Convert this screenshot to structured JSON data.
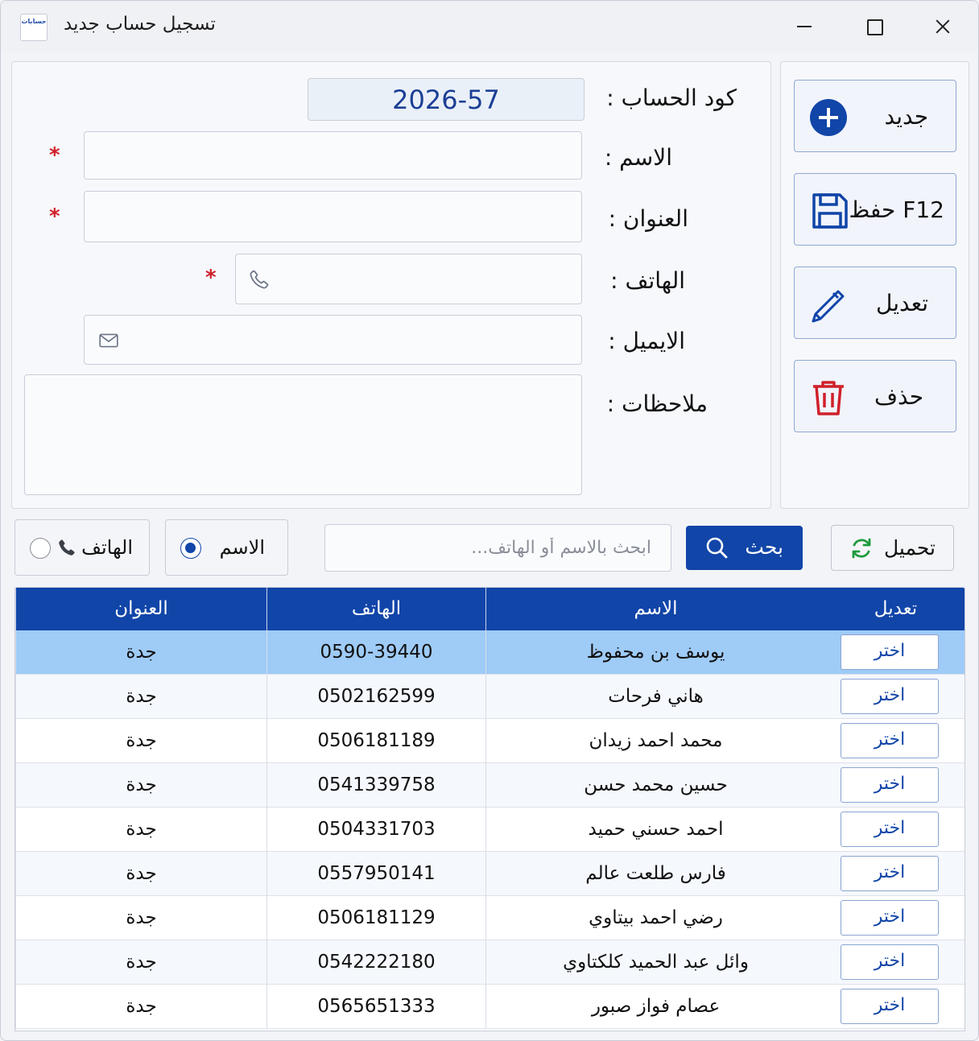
{
  "window": {
    "title": "تسجيل حساب جديد",
    "app_icon_text": "حسابات"
  },
  "form": {
    "code_label": "كود الحساب :",
    "code_value": "2026-57",
    "name_label": "الاسم :",
    "address_label": "العنوان :",
    "phone_label": "الهاتف :",
    "email_label": "الايميل :",
    "notes_label": "ملاحظات :",
    "required_mark": "*"
  },
  "actions": {
    "new_label": "جديد",
    "save_label": "F12 حفظ",
    "edit_label": "تعديل",
    "delete_label": "حذف"
  },
  "search": {
    "by_name_label": "الاسم",
    "by_phone_label": "الهاتف",
    "selected_mode": "name",
    "placeholder": "ابحث بالاسم أو الهاتف...",
    "search_label": "بحث",
    "load_label": "تحميل"
  },
  "colors": {
    "accent": "#1145a8",
    "selected_row": "#9fcbf7",
    "delete_icon": "#d0202a",
    "refresh_icon": "#1e9c3c"
  },
  "grid": {
    "columns": [
      "تعديل",
      "الاسم",
      "الهاتف",
      "العنوان"
    ],
    "pick_label": "اختر",
    "selected_row_index": 0,
    "rows": [
      {
        "name": "يوسف بن محفوظ",
        "phone": "0590-39440",
        "address": "جدة"
      },
      {
        "name": "هاني فرحات",
        "phone": "0502162599",
        "address": "جدة"
      },
      {
        "name": "محمد احمد زيدان",
        "phone": "0506181189",
        "address": "جدة"
      },
      {
        "name": "حسين محمد حسن",
        "phone": "0541339758",
        "address": "جدة"
      },
      {
        "name": "احمد حسني حميد",
        "phone": "0504331703",
        "address": "جدة"
      },
      {
        "name": "فارس طلعت عالم",
        "phone": "0557950141",
        "address": "جدة"
      },
      {
        "name": "رضي احمد بيتاوي",
        "phone": "0506181129",
        "address": "جدة"
      },
      {
        "name": "وائل عبد الحميد كلكتاوي",
        "phone": "0542222180",
        "address": "جدة"
      },
      {
        "name": "عصام فواز صبور",
        "phone": "0565651333",
        "address": "جدة"
      }
    ]
  }
}
